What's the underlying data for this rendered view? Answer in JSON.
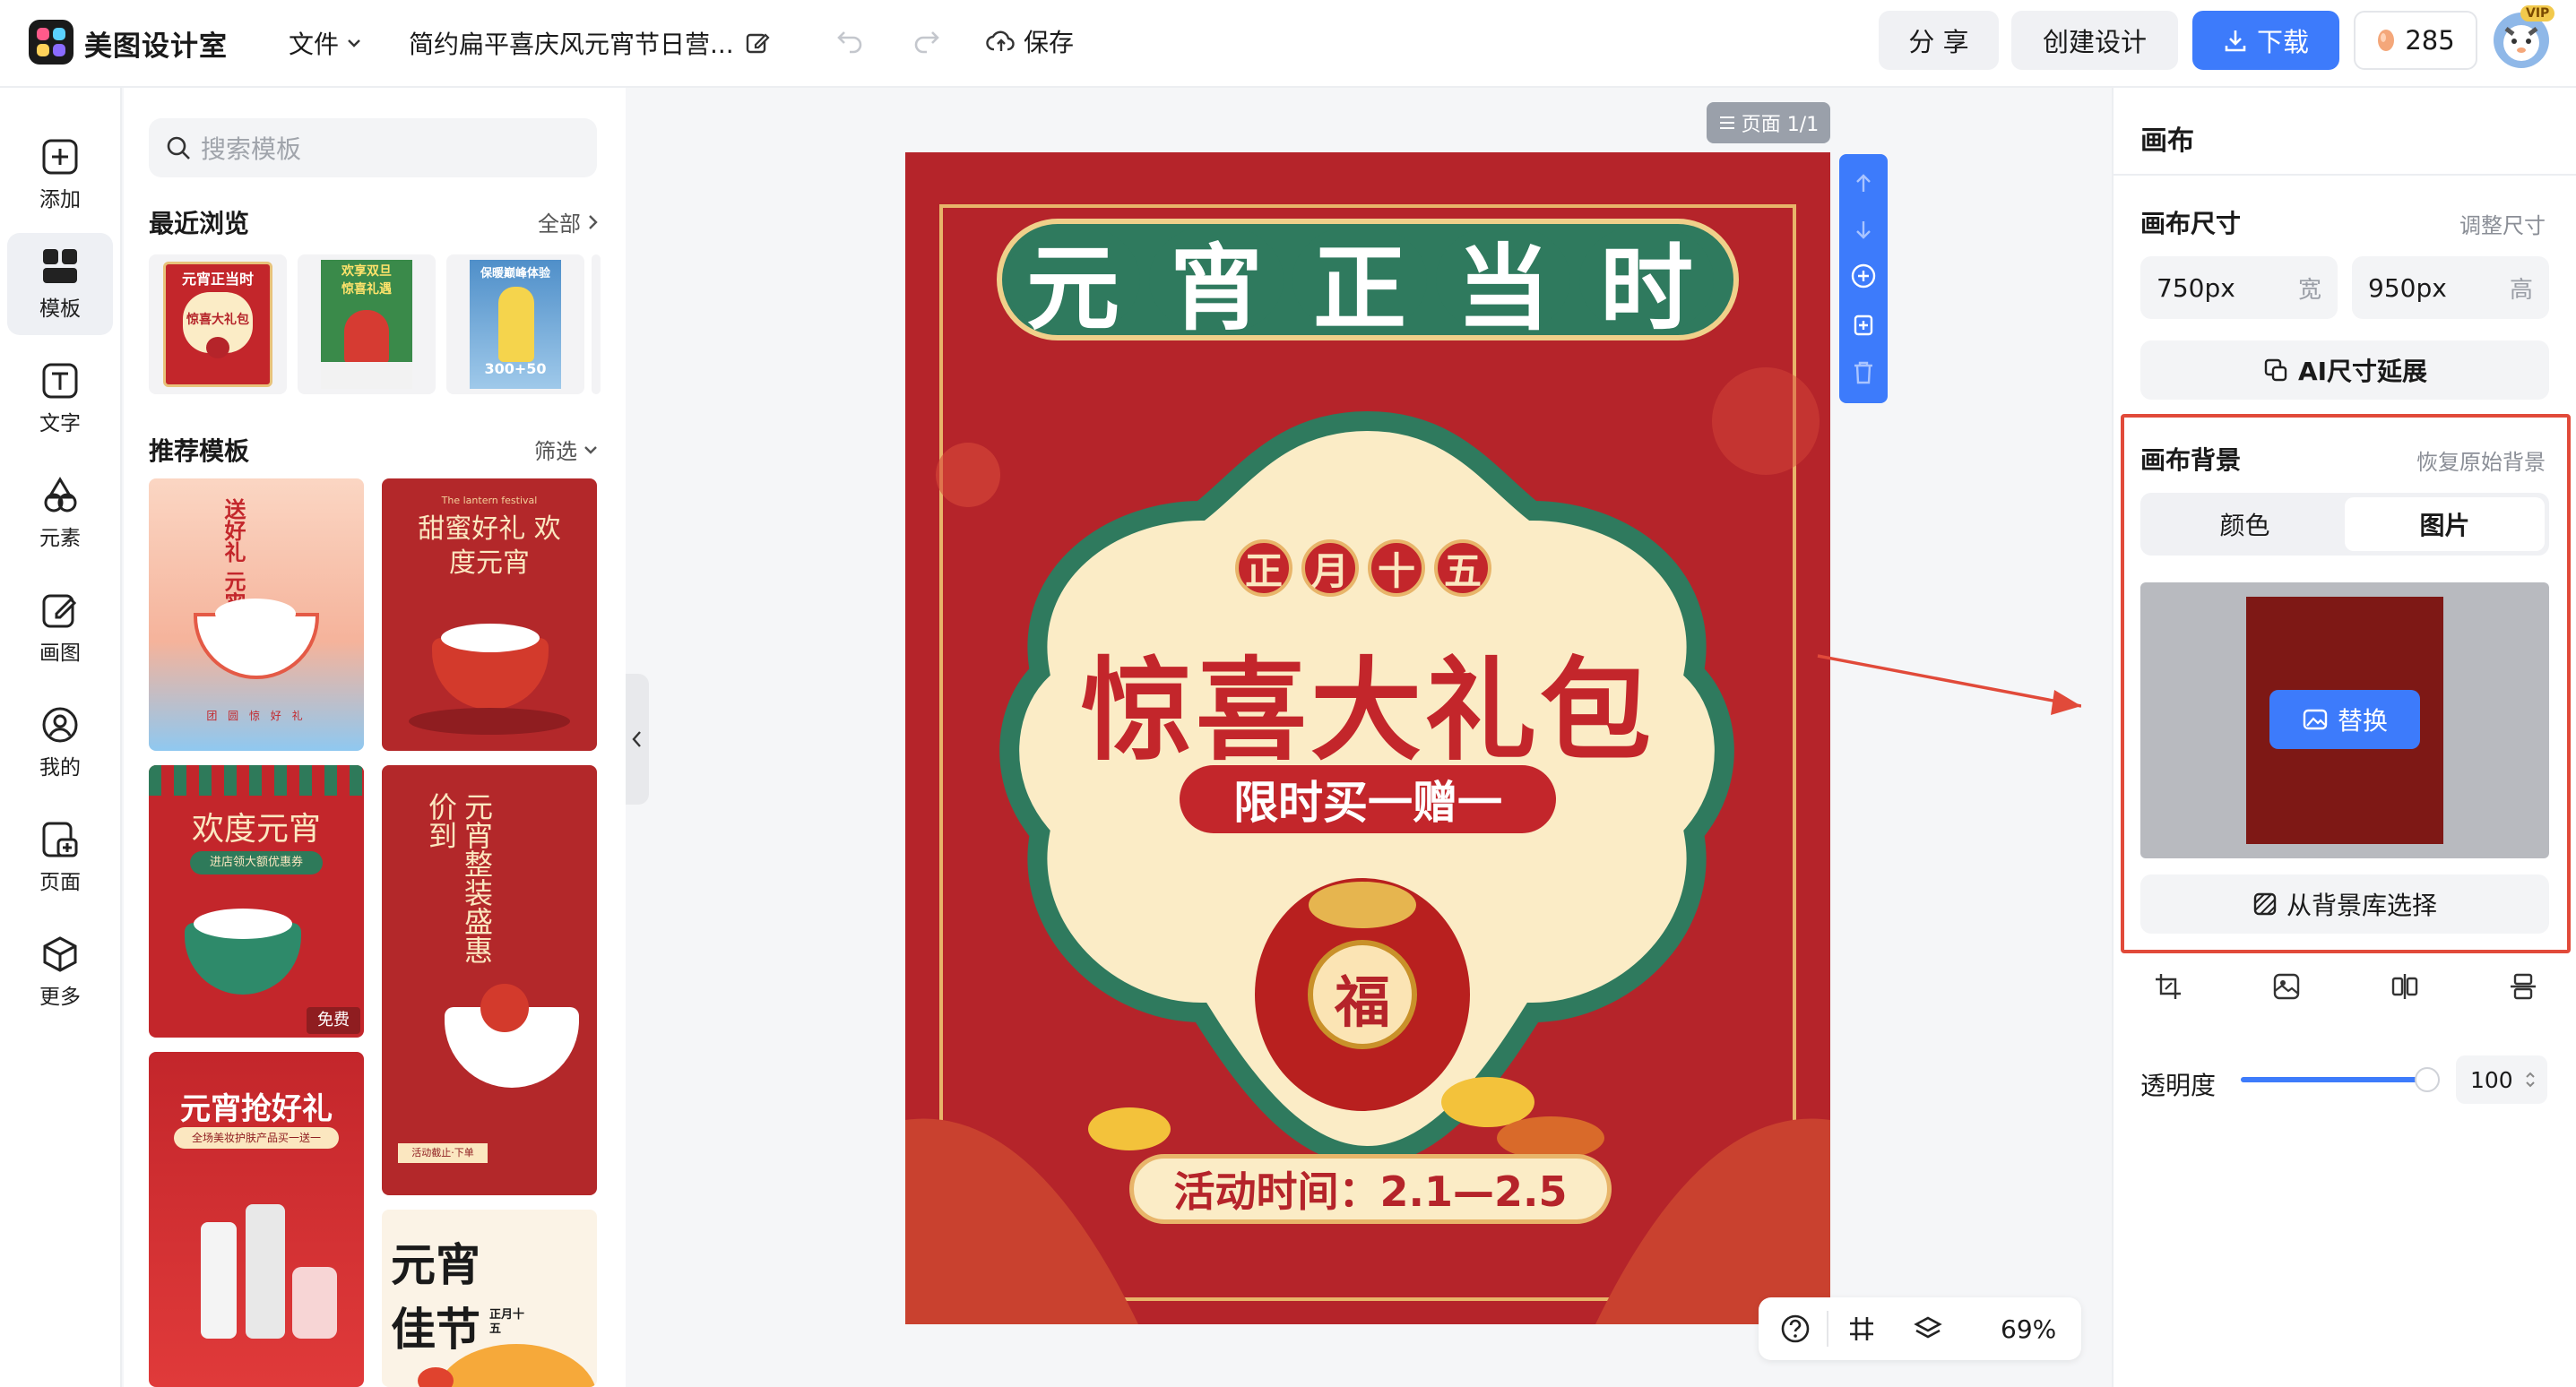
{
  "app": {
    "name": "美图设计室"
  },
  "topbar": {
    "file_menu": "文件",
    "doc_title": "简约扁平喜庆风元宵节日营...",
    "save_label": "保存",
    "share_label": "分 享",
    "create_label": "创建设计",
    "download_label": "下载",
    "credits": "285",
    "vip_badge": "VIP"
  },
  "leftnav": {
    "items": [
      {
        "label": "添加",
        "icon": "plus-square-icon"
      },
      {
        "label": "模板",
        "icon": "template-grid-icon"
      },
      {
        "label": "文字",
        "icon": "text-icon"
      },
      {
        "label": "元素",
        "icon": "shapes-icon"
      },
      {
        "label": "画图",
        "icon": "draw-icon"
      },
      {
        "label": "我的",
        "icon": "user-icon"
      },
      {
        "label": "页面",
        "icon": "page-add-icon"
      },
      {
        "label": "更多",
        "icon": "cube-icon"
      }
    ]
  },
  "panel": {
    "search_placeholder": "搜索模板",
    "recent_title": "最近浏览",
    "recent_link": "全部",
    "recommended_title": "推荐模板",
    "filter_label": "筛选",
    "recent": [
      {
        "lines": [
          "元宵正当时",
          "惊喜大礼包"
        ]
      },
      {
        "lines": [
          "欢享双旦",
          "惊喜礼遇"
        ]
      },
      {
        "lines": [
          "保暖巅峰体验",
          "300+50"
        ]
      }
    ],
    "templates": [
      {
        "title": "送好礼 元宵",
        "footer": "团 圆 惊 好 礼"
      },
      {
        "title": "甜蜜好礼 欢度元宵",
        "footer": "The lantern festival"
      },
      {
        "title": "欢度元宵",
        "footer": "进店领大额优惠券",
        "badge": "免费"
      },
      {
        "title": "元宵整装盛惠价到",
        "footer": "活动截止·下单"
      },
      {
        "title": "元宵抢好礼",
        "footer": "全场美妆护肤产品买一送一"
      },
      {
        "title": "元宵佳节",
        "footer": "正月十五"
      }
    ]
  },
  "canvas": {
    "page_badge": "页面 1/1",
    "zoom": "69%",
    "poster": {
      "headline": [
        "元",
        "宵",
        "正",
        "当",
        "时"
      ],
      "date_chars": [
        "正",
        "月",
        "十",
        "五"
      ],
      "main_title": "惊喜大礼包",
      "ribbon": "限时买一赠一",
      "bag_char": "福",
      "activity_time": "活动时间：2.1—2.5"
    }
  },
  "rightpanel": {
    "title": "画布",
    "size_title": "画布尺寸",
    "size_adjust": "调整尺寸",
    "width_value": "750px",
    "width_unit": "宽",
    "height_value": "950px",
    "height_unit": "高",
    "ai_extend": "AI尺寸延展",
    "bg_title": "画布背景",
    "bg_restore": "恢复原始背景",
    "tab_color": "颜色",
    "tab_image": "图片",
    "replace_label": "替换",
    "library_label": "从背景库选择",
    "opacity_label": "透明度",
    "opacity_value": "100",
    "opacity_level": 1.0
  },
  "colors": {
    "accent": "#3d7bfb",
    "poster_red": "#b5242a",
    "teal": "#2f7a5e",
    "cream": "#fbecc6",
    "highlight": "#e14a3a"
  }
}
